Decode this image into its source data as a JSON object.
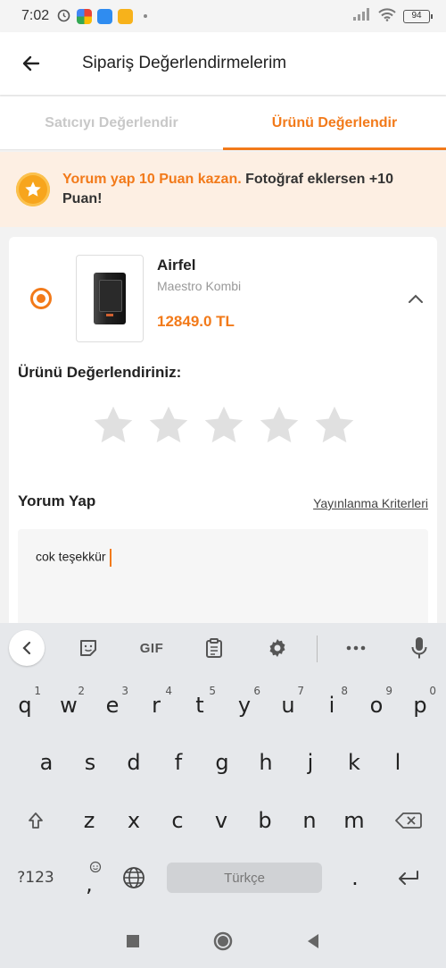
{
  "status_bar": {
    "time": "7:02",
    "battery": "94"
  },
  "header": {
    "title": "Sipariş Değerlendirmelerim"
  },
  "tabs": [
    {
      "label": "Satıcıyı Değerlendir"
    },
    {
      "label": "Ürünü Değerlendir"
    }
  ],
  "banner": {
    "highlight": "Yorum yap 10 Puan kazan.",
    "rest": " Fotoğraf eklersen +10 Puan!"
  },
  "product": {
    "brand": "Airfel",
    "name": "Maestro Kombi",
    "price": "12849.0 TL"
  },
  "rating": {
    "label": "Ürünü Değerlendiriniz:",
    "stars_selected": 0,
    "stars_total": 5
  },
  "review": {
    "label": "Yorum Yap",
    "criteria_link": "Yayınlanma Kriterleri",
    "text": "cok teşekkür"
  },
  "keyboard": {
    "gif_label": "GIF",
    "row1": [
      "q",
      "w",
      "e",
      "r",
      "t",
      "y",
      "u",
      "i",
      "o",
      "p"
    ],
    "row1_nums": [
      "1",
      "2",
      "3",
      "4",
      "5",
      "6",
      "7",
      "8",
      "9",
      "0"
    ],
    "row2": [
      "a",
      "s",
      "d",
      "f",
      "g",
      "h",
      "j",
      "k",
      "l"
    ],
    "row3": [
      "z",
      "x",
      "c",
      "v",
      "b",
      "n",
      "m"
    ],
    "symbols_label": "?123",
    "comma": ",",
    "space_label": "Türkçe",
    "period": "."
  },
  "colors": {
    "accent": "#f27a1a",
    "banner_bg": "#fdefe3",
    "star_gray": "#e0e0e0"
  }
}
